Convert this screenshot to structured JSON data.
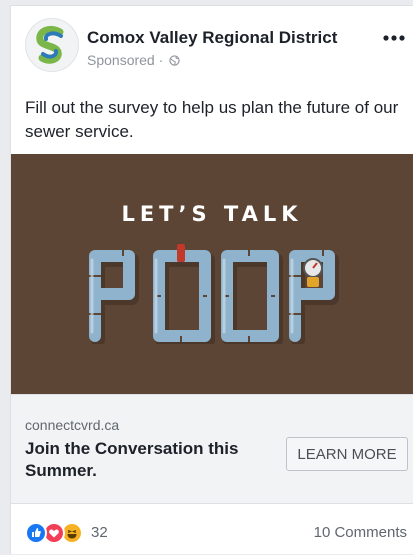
{
  "post": {
    "page_name": "Comox Valley Regional District",
    "sponsored_label": "Sponsored",
    "separator": "·",
    "privacy_icon": "globe-icon",
    "more_icon": "more-options-icon",
    "text": "Fill out the survey to help us plan the future of our sewer service."
  },
  "ad_image": {
    "top_text": "LET’S TALK",
    "big_text": "POOP",
    "background_color": "#5c4535",
    "pipe_color": "#8fb3cc"
  },
  "link": {
    "domain": "connectcvrd.ca",
    "headline": "Join the Conversation this Summer.",
    "cta_label": "LEARN MORE"
  },
  "footer": {
    "reactions": [
      {
        "name": "like-reaction-icon",
        "color": "#1877f2"
      },
      {
        "name": "love-reaction-icon",
        "color": "#f33e58"
      },
      {
        "name": "haha-reaction-icon",
        "color": "#f7b125"
      }
    ],
    "reaction_count": "32",
    "comments": "10 Comments"
  }
}
